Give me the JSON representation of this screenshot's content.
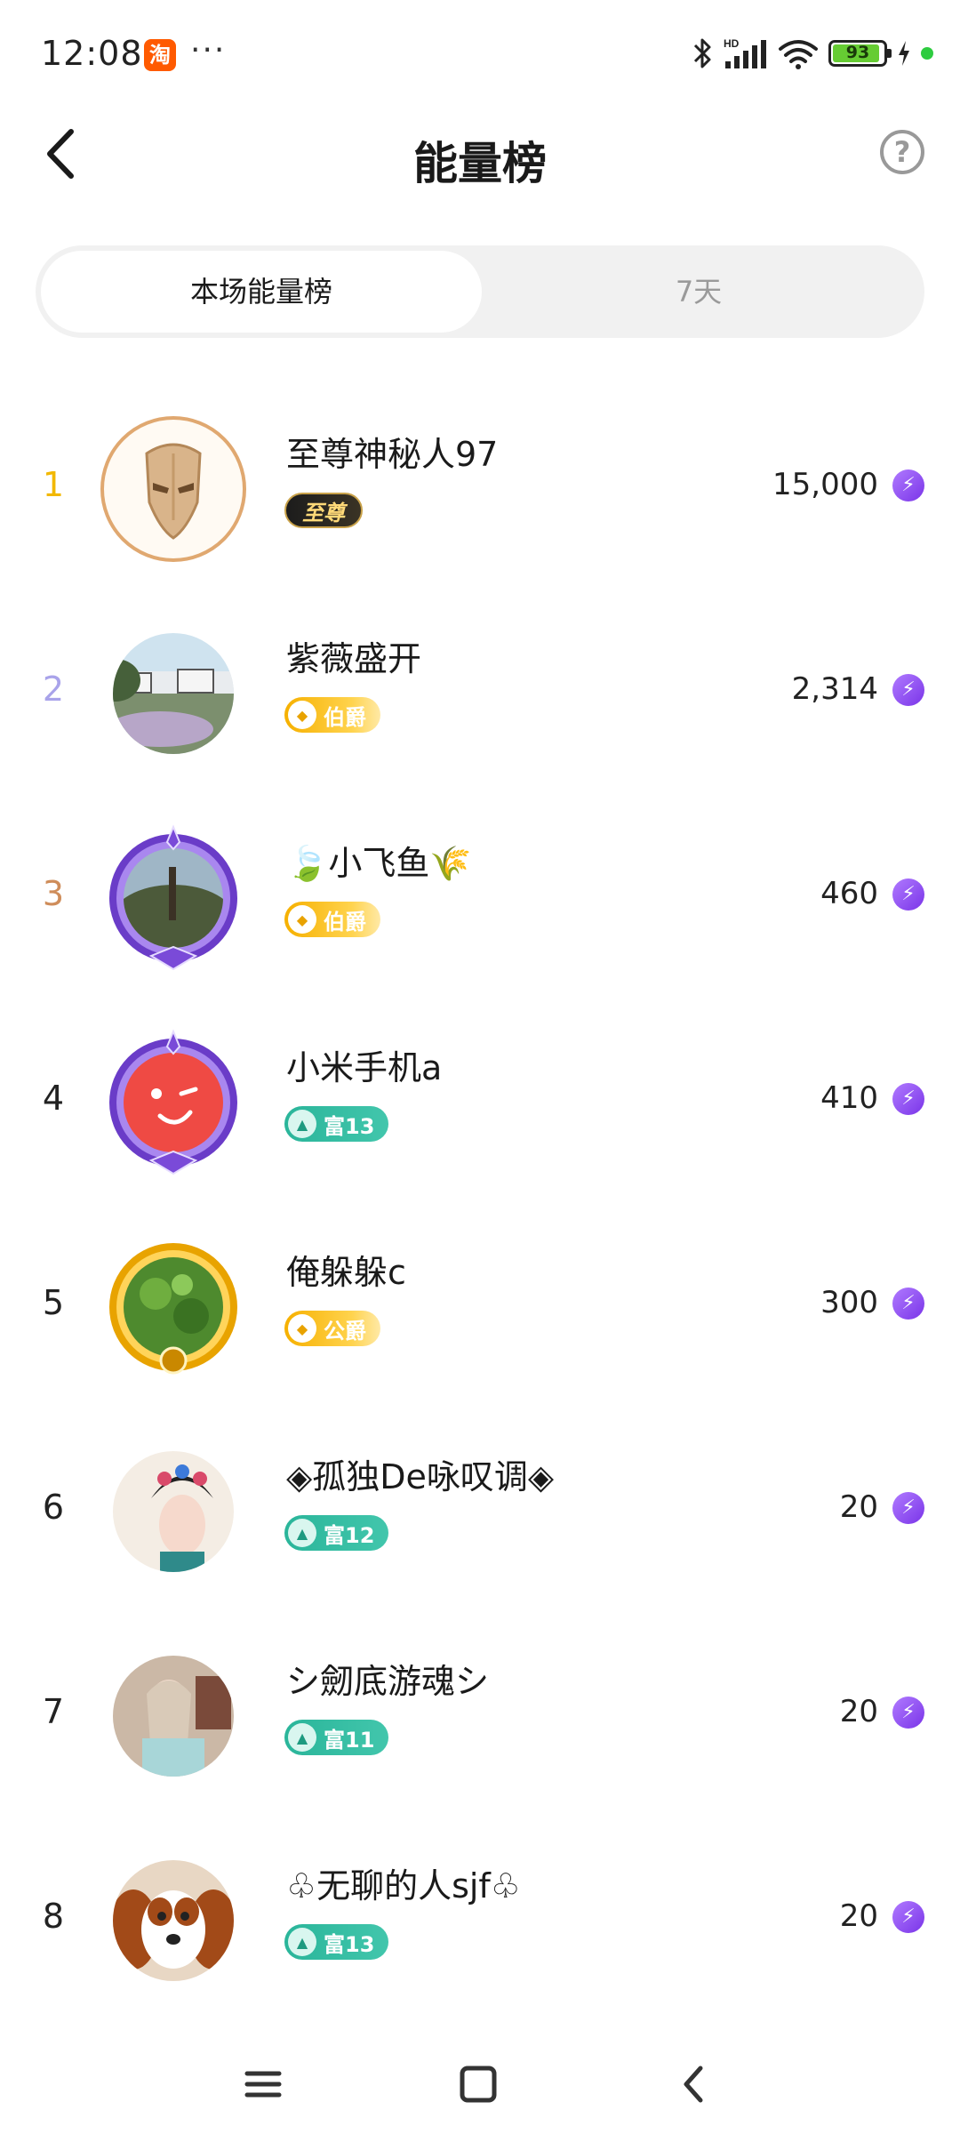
{
  "status_bar": {
    "time": "12:08",
    "app_badge": "淘",
    "more": "···",
    "network": "HD",
    "battery": "93"
  },
  "header": {
    "title": "能量榜",
    "help": "?"
  },
  "tabs": [
    {
      "label": "本场能量榜",
      "active": true
    },
    {
      "label": "7天",
      "active": false
    }
  ],
  "ranking": [
    {
      "rank": "1",
      "name": "至尊神秘人97",
      "badge": "至尊",
      "badge_type": "zhizun",
      "score": "15,000"
    },
    {
      "rank": "2",
      "name": "紫薇盛开",
      "badge": "伯爵",
      "badge_type": "gold",
      "score": "2,314"
    },
    {
      "rank": "3",
      "name": "🍃小飞鱼🌾",
      "badge": "伯爵",
      "badge_type": "gold",
      "score": "460"
    },
    {
      "rank": "4",
      "name": "小米手机a",
      "badge": "富13",
      "badge_type": "green",
      "score": "410"
    },
    {
      "rank": "5",
      "name": "俺躲躲c",
      "badge": "公爵",
      "badge_type": "gold",
      "score": "300"
    },
    {
      "rank": "6",
      "name": "◈孤独De咏叹调◈",
      "badge": "富12",
      "badge_type": "green",
      "score": "20"
    },
    {
      "rank": "7",
      "name": "シ劒底游魂シ",
      "badge": "富11",
      "badge_type": "green",
      "score": "20"
    },
    {
      "rank": "8",
      "name": "♧无聊的人sjf♧",
      "badge": "富13",
      "badge_type": "green",
      "score": "20"
    }
  ],
  "colors": {
    "rank1": "#f2b800",
    "rank2": "#a9a3ea",
    "rank3": "#cf8d5a",
    "energy_icon": "#8a45f0",
    "badge_gold": "#f6b000",
    "badge_green": "#2ab59a"
  },
  "icons": {
    "energy": "lightning-icon",
    "back": "chevron-left-icon",
    "help": "question-circle-icon"
  }
}
